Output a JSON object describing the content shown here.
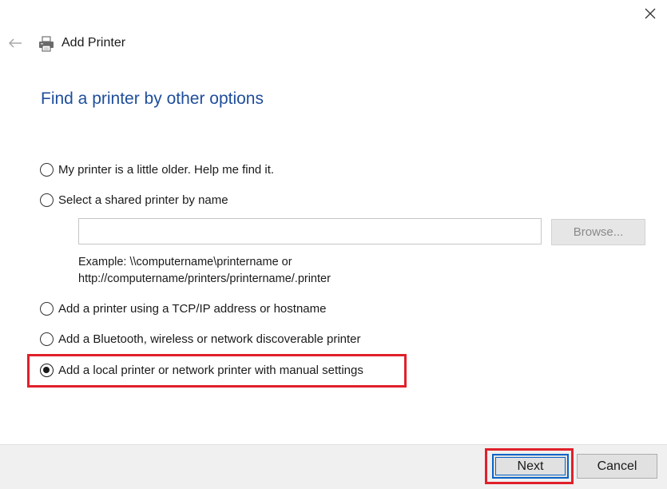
{
  "window": {
    "title": "Add Printer",
    "close_icon": "close-icon",
    "back_icon": "back-arrow-icon",
    "title_icon": "printer-icon"
  },
  "heading": "Find a printer by other options",
  "options": [
    {
      "label": "My printer is a little older. Help me find it.",
      "checked": false
    },
    {
      "label": "Select a shared printer by name",
      "checked": false
    },
    {
      "label": "Add a printer using a TCP/IP address or hostname",
      "checked": false
    },
    {
      "label": "Add a Bluetooth, wireless or network discoverable printer",
      "checked": false
    },
    {
      "label": "Add a local printer or network printer with manual settings",
      "checked": true
    }
  ],
  "shared_printer": {
    "value": "",
    "browse_label": "Browse...",
    "example_line1": "Example: \\\\computername\\printername or",
    "example_line2": "http://computername/printers/printername/.printer"
  },
  "footer": {
    "next_label": "Next",
    "cancel_label": "Cancel"
  },
  "colors": {
    "heading": "#1f4e9b",
    "highlight": "#e0202a",
    "focus": "#0a64c8"
  }
}
